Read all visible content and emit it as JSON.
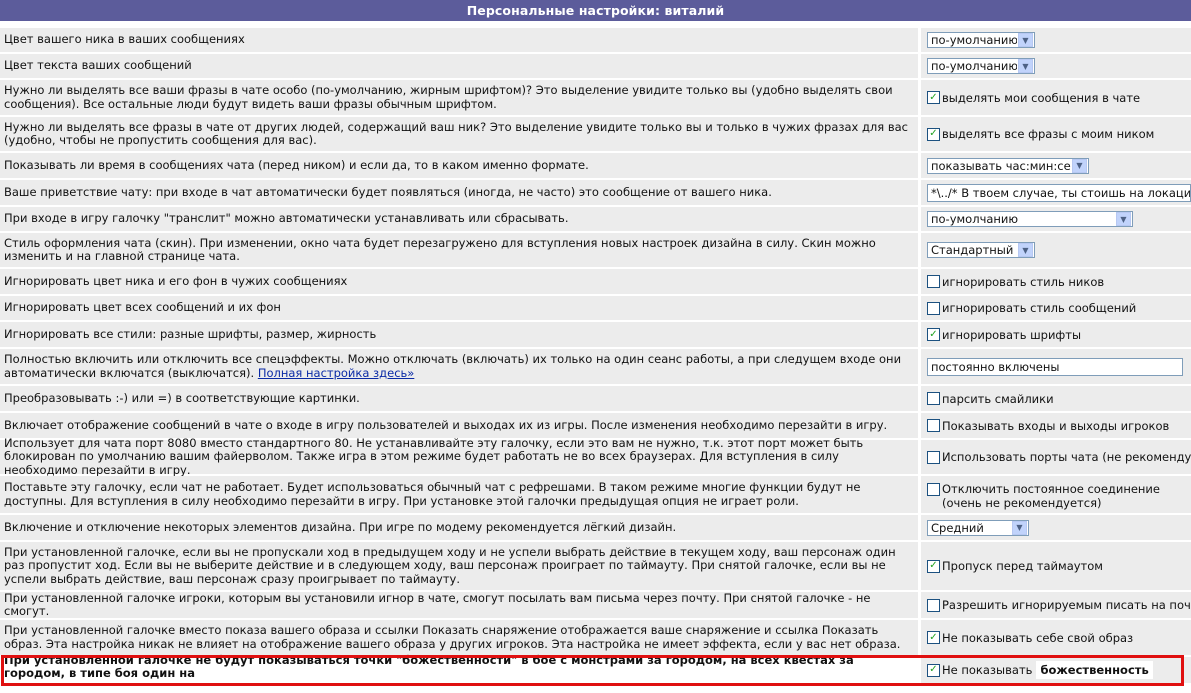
{
  "title": "Персональные настройки: виталий",
  "rows": {
    "r0": {
      "desc": "Цвет вашего ника в ваших сообщениях",
      "select": "по-умолчанию"
    },
    "r1": {
      "desc": "Цвет текста ваших сообщений",
      "select": "по-умолчанию"
    },
    "r2": {
      "desc": "Нужно ли выделять все ваши фразы в чате особо (по-умолчанию, жирным шрифтом)? Это выделение увидите только вы (удобно выделять свои сообщения). Все остальные люди будут видеть ваши фразы обычным шрифтом.",
      "checkbox": "выделять мои сообщения в чате",
      "checked": true
    },
    "r3": {
      "desc": "Нужно ли выделять все фразы в чате от других людей, содержащий ваш ник? Это выделение увидите только вы и только в чужих фразах для вас (удобно, чтобы не пропустить сообщения для вас).",
      "checkbox": "выделять все фразы с моим ником",
      "checked": true
    },
    "r4": {
      "desc": "Показывать ли время в сообщениях чата (перед ником) и если да, то в каком именно формате.",
      "select": "показывать час:мин:сек"
    },
    "r5": {
      "desc": "Ваше приветствие чату: при входе в чат автоматически будет появляться (иногда, не часто) это сообщение от вашего ника.",
      "input": "*\\../* В твоем случае, ты стоишь на локации"
    },
    "r6": {
      "desc": "При входе в игру галочку \"транслит\" можно автоматически устанавливать или сбрасывать.",
      "select": "по-умолчанию"
    },
    "r7": {
      "desc": "Стиль оформления чата (скин). При изменении, окно чата будет перезагружено для вступления новых настроек дизайна в силу. Скин можно изменить и на главной странице чата.",
      "select": "Стандартный"
    },
    "r8": {
      "desc": "Игнорировать цвет ника и его фон в чужих сообщениях",
      "checkbox": "игнорировать стиль ников",
      "checked": false
    },
    "r9": {
      "desc": "Игнорировать цвет всех сообщений и их фон",
      "checkbox": "игнорировать стиль сообщений",
      "checked": false
    },
    "r10": {
      "desc": "Игнорировать все стили: разные шрифты, размер, жирность",
      "checkbox": "игнорировать шрифты",
      "checked": true
    },
    "r11": {
      "desc": "Полностью включить или отключить все спецэффекты. Можно отключать (включать) их только на один сеанс работы, а при следущем входе они автоматически включатся (выключатся).",
      "link": "Полная настройка здесь»",
      "select": "постоянно включены"
    },
    "r12": {
      "desc": "Преобразовывать :-) или =) в соответствующие картинки.",
      "checkbox": "парсить смайлики",
      "checked": false
    },
    "r13": {
      "desc": "Включает отображение сообщений в чате о входе в игру пользователей и выходах их из игры. После изменения необходимо перезайти в игру.",
      "checkbox": "Показывать входы и выходы игроков",
      "checked": false
    },
    "r14": {
      "desc": "Использует для чата порт 8080 вместо стандартного 80. Не устанавливайте эту галочку, если это вам не нужно, т.к. этот порт может быть блокирован по умолчанию вашим файерволом. Также игра в этом режиме будет работать не во всех браузерах. Для вступления в силу необходимо перезайти в игру.",
      "checkbox": "Использовать порты чата (не рекомендуется)",
      "checked": false
    },
    "r15": {
      "desc": "Поставьте эту галочку, если чат не работает. Будет использоваться обычный чат с рефрешами. В таком режиме многие функции будут не доступны. Для вступления в силу необходимо перезайти в игру. При установке этой галочки предыдущая опция не играет роли.",
      "checkbox": "Отключить постоянное соединение (очень не рекомендуется)",
      "checked": false
    },
    "r16": {
      "desc": "Включение и отключение некоторых элементов дизайна. При игре по модему рекомендуется лёгкий дизайн.",
      "select": "Средний"
    },
    "r17": {
      "desc": "При установленной галочке, если вы не пропускали ход в предыдущем ходу и не успели выбрать действие в текущем ходу, ваш персонаж один раз пропустит ход. Если вы не выберите действие и в следующем ходу, ваш персонаж проиграет по таймауту. При снятой галочке, если вы не успели выбрать действие, ваш персонаж сразу проигрывает по таймауту.",
      "checkbox": "Пропуск перед таймаутом",
      "checked": true
    },
    "r18": {
      "desc": "При установленной галочке игроки, которым вы установили игнор в чате, смогут посылать вам письма через почту. При снятой галочке - не смогут.",
      "checkbox": "Разрешить игнорируемым писать на почту",
      "checked": false
    },
    "r19": {
      "desc": "При установленной галочке вместо показа вашего образа и ссылки Показать снаряжение отображается ваше снаряжение и ссылка Показать образ. Эта настройка никак не влияет на отображение вашего образа у других игроков. Эта настройка не имеет эффекта, если у вас нет образа.",
      "checkbox": "Не показывать себе свой образ",
      "checked": true
    },
    "r20": {
      "desc": "При установленной галочке не будут показываться точки \"божественности\" в бое с монстрами за городом, на всех квестах за городом, в типе боя один на",
      "checkbox": "Не показывать",
      "extra": "божественность",
      "checked": true
    }
  }
}
